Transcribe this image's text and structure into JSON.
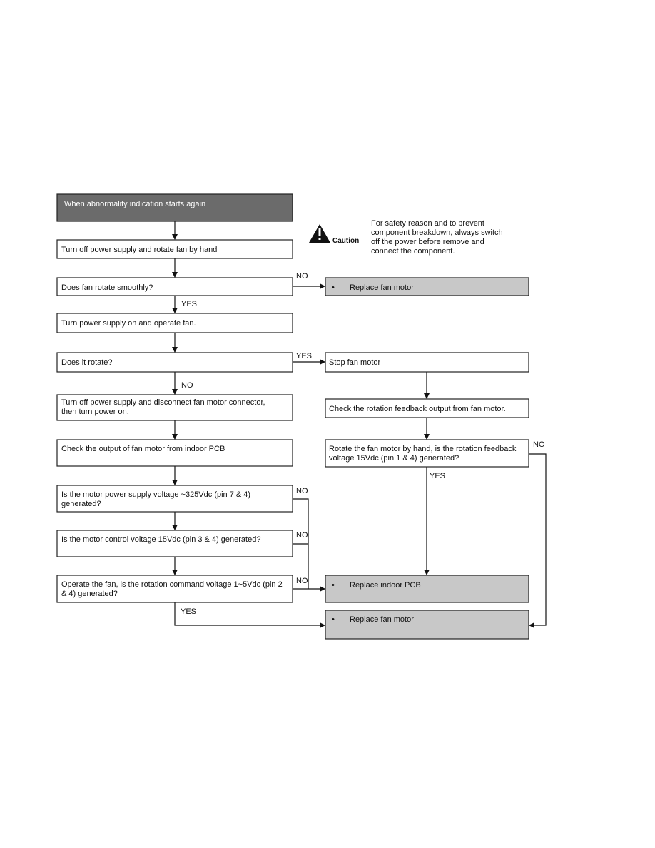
{
  "flowchart": {
    "start": "When abnormality indication starts again",
    "caution": {
      "icon": "warning-triangle-icon",
      "label": "Caution",
      "lines": [
        "For safety reason and to prevent",
        "component breakdown, always switch",
        "off the power before remove and",
        "connect the component."
      ]
    },
    "left": [
      {
        "lines": [
          "Turn off power supply and rotate fan by hand"
        ]
      },
      {
        "lines": [
          "Does fan rotate smoothly?"
        ]
      },
      {
        "lines": [
          "Turn power supply on and operate fan."
        ]
      },
      {
        "lines": [
          "Does it rotate?"
        ]
      },
      {
        "lines": [
          "Turn off power supply and disconnect fan motor connector,",
          "then turn power on."
        ]
      },
      {
        "lines": [
          "Check the output of fan motor from indoor PCB"
        ]
      },
      {
        "lines": [
          "Is the motor power supply voltage ~325Vdc (pin 7 & 4)",
          "generated?"
        ]
      },
      {
        "lines": [
          "Is the motor control voltage 15Vdc (pin 3 & 4) generated?"
        ]
      },
      {
        "lines": [
          "Operate the fan, is the rotation command voltage 1~5Vdc (pin 2",
          "& 4) generated?"
        ]
      }
    ],
    "right": [
      {
        "bullet": "•",
        "lines": [
          "Replace fan motor"
        ]
      },
      {
        "lines": [
          "Stop fan motor"
        ]
      },
      {
        "lines": [
          "Check the rotation feedback output from fan motor."
        ]
      },
      {
        "lines": [
          "Rotate the fan motor by hand, is the rotation feedback",
          "voltage 15Vdc (pin 1 & 4) generated?"
        ]
      },
      {
        "bullet": "•",
        "lines": [
          "Replace indoor PCB"
        ]
      },
      {
        "bullet": "•",
        "lines": [
          "Replace fan motor"
        ]
      }
    ],
    "labels": {
      "no": "NO",
      "yes": "YES"
    },
    "colors": {
      "start_fill": "#6b6b6b",
      "result_fill": "#c8c8c8"
    }
  }
}
